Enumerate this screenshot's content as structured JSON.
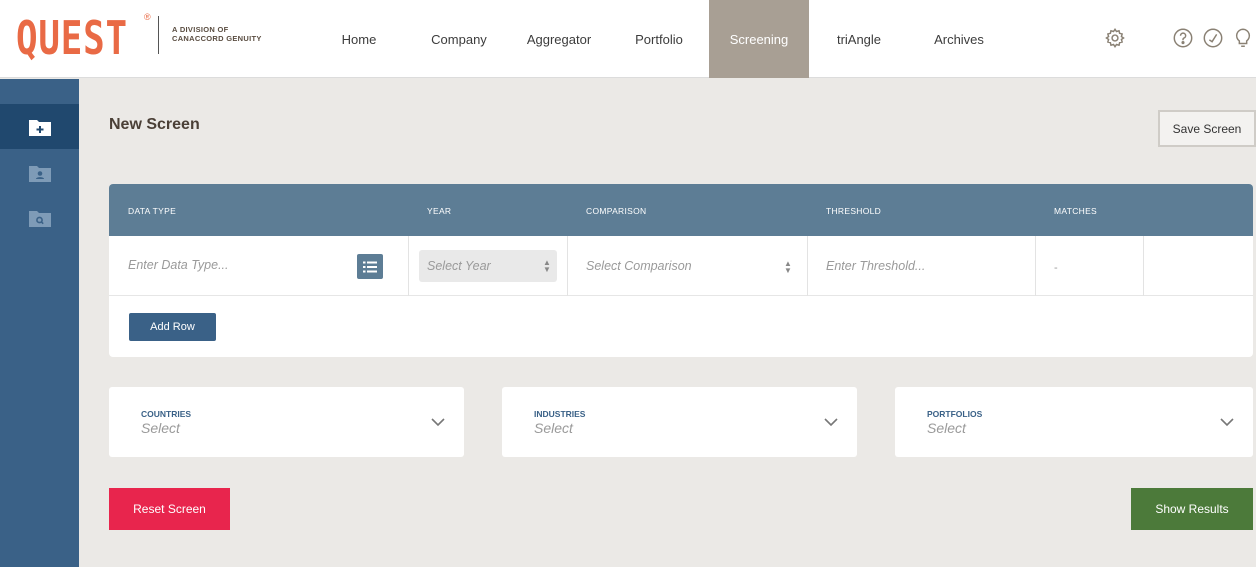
{
  "brand": {
    "logo_text": "QUEST",
    "registered": "®",
    "tagline_line1": "A DIVISION OF",
    "tagline_line2": "CANACCORD GENUITY",
    "logo_color": "#e96a45"
  },
  "nav": {
    "items": [
      {
        "label": "Home"
      },
      {
        "label": "Company"
      },
      {
        "label": "Aggregator"
      },
      {
        "label": "Portfolio"
      },
      {
        "label": "Screening",
        "active": true
      },
      {
        "label": "triAngle"
      },
      {
        "label": "Archives"
      }
    ],
    "icons": [
      "settings-gear-icon",
      "help-icon",
      "check-icon",
      "lightbulb-icon"
    ]
  },
  "sidebar": {
    "items": [
      {
        "icon": "new-folder-icon",
        "active": true
      },
      {
        "icon": "user-folder-icon"
      },
      {
        "icon": "query-folder-icon"
      }
    ]
  },
  "page": {
    "title": "New Screen",
    "save_label": "Save Screen"
  },
  "table": {
    "headers": [
      "DATA TYPE",
      "YEAR",
      "COMPARISON",
      "THRESHOLD",
      "MATCHES"
    ],
    "row": {
      "data_type_placeholder": "Enter Data Type...",
      "year_placeholder": "Select Year",
      "comparison_placeholder": "Select Comparison",
      "threshold_placeholder": "Enter Threshold...",
      "matches": "-"
    },
    "add_row_label": "Add Row"
  },
  "filters": [
    {
      "label": "COUNTRIES",
      "value": "Select"
    },
    {
      "label": "INDUSTRIES",
      "value": "Select"
    },
    {
      "label": "PORTFOLIOS",
      "value": "Select"
    }
  ],
  "actions": {
    "reset_label": "Reset Screen",
    "show_label": "Show Results"
  },
  "colors": {
    "nav_active": "#a89f94",
    "sidebar": "#3a6187",
    "table_header": "#5d7d95",
    "reset": "#e8254d",
    "show_results": "#4c7a3a"
  }
}
